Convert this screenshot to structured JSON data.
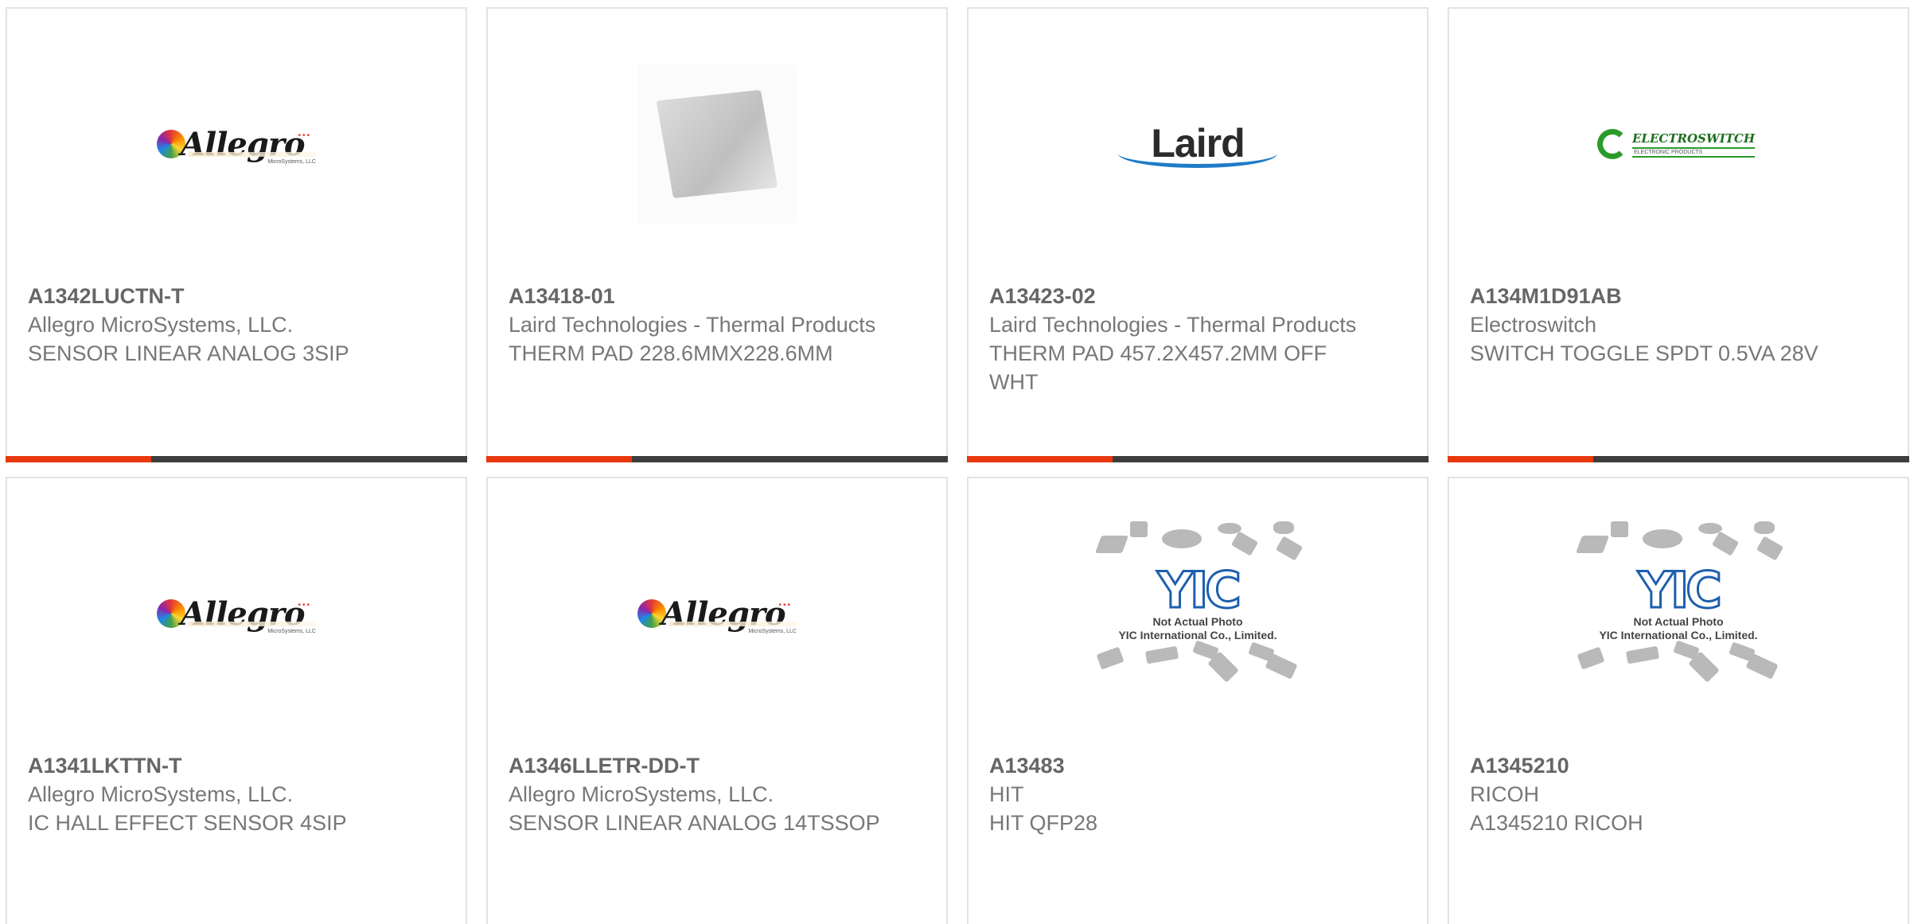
{
  "products": [
    {
      "part_number": "A1342LUCTN-T",
      "manufacturer": "Allegro MicroSystems, LLC.",
      "description": "SENSOR LINEAR ANALOG 3SIP",
      "image": "allegro-logo",
      "logo": {
        "sub": "MicroSystems, LLC"
      }
    },
    {
      "part_number": "A13418-01",
      "manufacturer": "Laird Technologies - Thermal Products",
      "description": "THERM PAD 228.6MMX228.6MM",
      "image": "thermal-pad-photo"
    },
    {
      "part_number": "A13423-02",
      "manufacturer": "Laird Technologies - Thermal Products",
      "description": "THERM PAD 457.2X457.2MM OFF WHT",
      "image": "laird-logo",
      "logo": {
        "word": "Laird"
      }
    },
    {
      "part_number": "A134M1D91AB",
      "manufacturer": "Electroswitch",
      "description": "SWITCH TOGGLE SPDT 0.5VA 28V",
      "image": "electroswitch-logo",
      "logo": {
        "word": "ELECTROSWITCH",
        "sub": "ELECTRONIC PRODUCTS"
      }
    },
    {
      "part_number": "A1341LKTTN-T",
      "manufacturer": "Allegro MicroSystems, LLC.",
      "description": "IC HALL EFFECT SENSOR 4SIP",
      "image": "allegro-logo",
      "logo": {
        "sub": "MicroSystems, LLC"
      }
    },
    {
      "part_number": "A1346LLETR-DD-T",
      "manufacturer": "Allegro MicroSystems, LLC.",
      "description": "SENSOR LINEAR ANALOG 14TSSOP",
      "image": "allegro-logo",
      "logo": {
        "sub": "MicroSystems, LLC"
      }
    },
    {
      "part_number": "A13483",
      "manufacturer": "HIT",
      "description": "HIT QFP28",
      "image": "yic-placeholder",
      "logo": {
        "caption1": "Not Actual Photo",
        "caption2": "YIC International Co., Limited."
      }
    },
    {
      "part_number": "A1345210",
      "manufacturer": "RICOH",
      "description": "A1345210 RICOH",
      "image": "yic-placeholder",
      "logo": {
        "caption1": "Not Actual Photo",
        "caption2": "YIC International Co., Limited."
      }
    }
  ],
  "colors": {
    "accent": "#e8380d",
    "bar": "#3d3d3d",
    "border": "#e3e3e3",
    "allegro_blue": "#1e5fae",
    "laird_blue": "#1e7bc8",
    "electroswitch_green": "#2a9b2a"
  }
}
